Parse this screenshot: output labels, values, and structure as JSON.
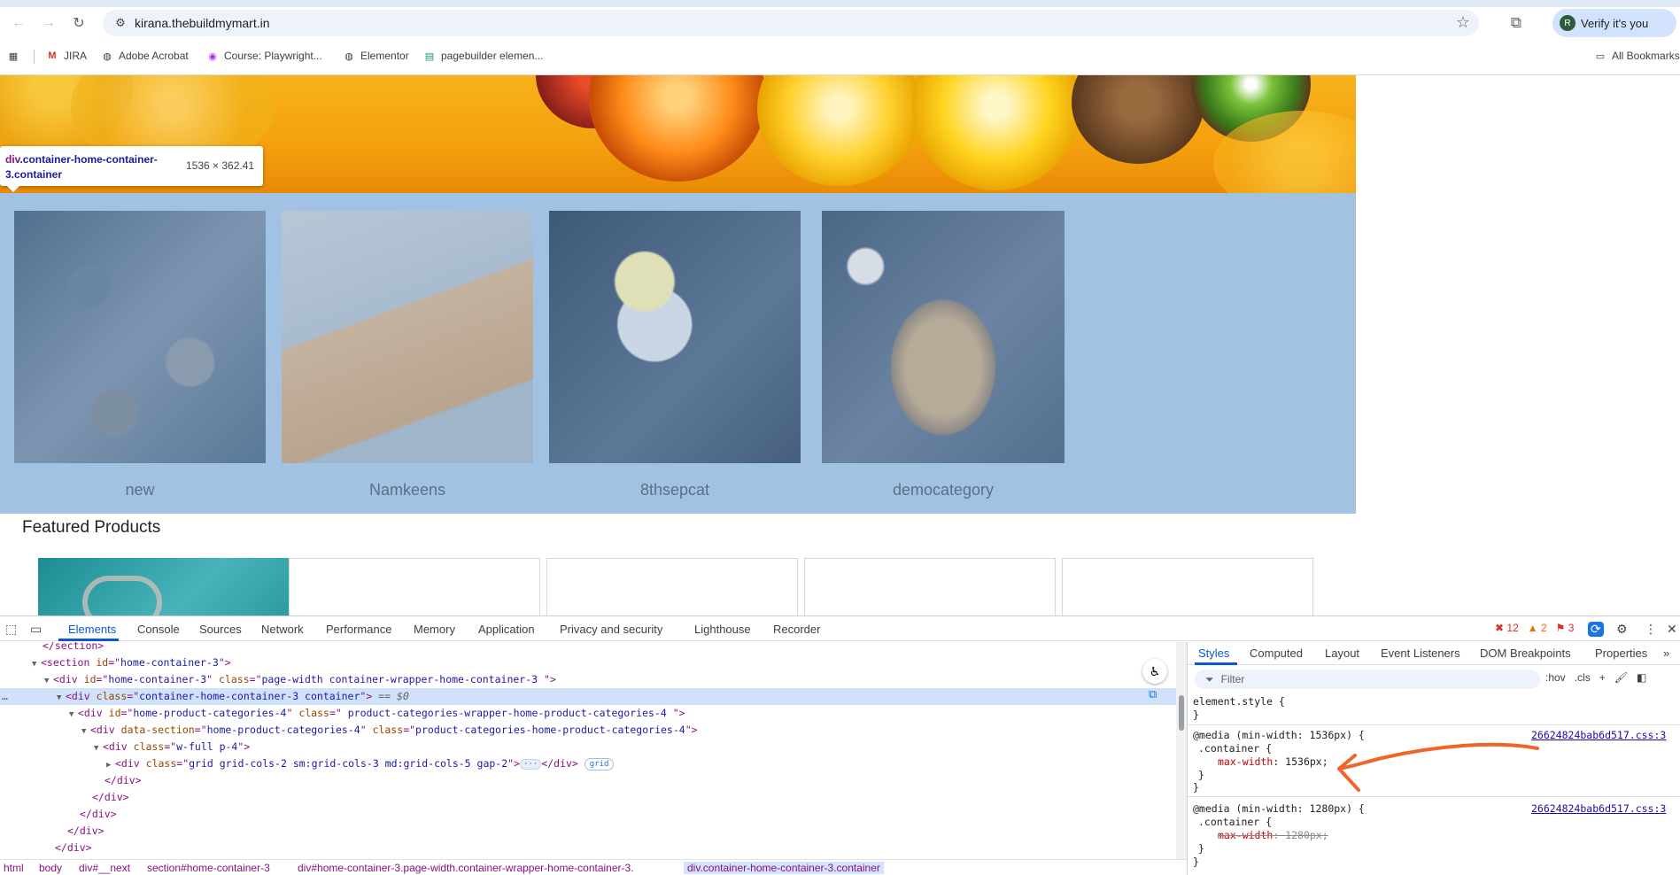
{
  "browser": {
    "url": "kirana.thebuildmymart.in",
    "verify_label": "Verify it's you",
    "avatar_letter": "R",
    "bookmarks": [
      {
        "label": "JIRA",
        "icon": "gmail-icon"
      },
      {
        "label": "Adobe Acrobat",
        "icon": "globe-icon"
      },
      {
        "label": "Course: Playwright...",
        "icon": "udemy-icon"
      },
      {
        "label": "Elementor",
        "icon": "globe-icon"
      },
      {
        "label": "pagebuilder elemen...",
        "icon": "sheets-icon"
      }
    ],
    "all_bookmarks_label": "All Bookmarks"
  },
  "page": {
    "inspect_tooltip": {
      "selector_tag": "div",
      "selector_class": ".container-home-container-3.container",
      "dimensions": "1536 × 362.41"
    },
    "categories": [
      {
        "label": "new"
      },
      {
        "label": "Namkeens"
      },
      {
        "label": "8thsepcat"
      },
      {
        "label": "democategory"
      }
    ],
    "featured_title": "Featured Products"
  },
  "devtools": {
    "tabs": [
      "Elements",
      "Console",
      "Sources",
      "Network",
      "Performance",
      "Memory",
      "Application",
      "Privacy and security",
      "Lighthouse",
      "Recorder"
    ],
    "active_tab": "Elements",
    "counts": {
      "errors": "12",
      "warnings": "2",
      "issues": "3"
    },
    "dom_lines": [
      {
        "indent": 3,
        "html": "</section>",
        "kind": "close"
      },
      {
        "indent": 3,
        "text_tag": "section",
        "attrs": [
          [
            "id",
            "home-container-3"
          ]
        ],
        "tri": "▼"
      },
      {
        "indent": 4,
        "text_tag": "div",
        "attrs": [
          [
            "id",
            "home-container-3"
          ],
          [
            "class",
            "page-width container-wrapper-home-container-3 "
          ]
        ],
        "tri": "▼"
      },
      {
        "indent": 5,
        "text_tag": "div",
        "attrs": [
          [
            "class",
            "container-home-container-3 container"
          ]
        ],
        "tri": "▼",
        "selected": true,
        "suffix": " == $0"
      },
      {
        "indent": 6,
        "text_tag": "div",
        "attrs": [
          [
            "id",
            "home-product-categories-4"
          ],
          [
            "class",
            " product-categories-wrapper-home-product-categories-4 "
          ]
        ],
        "tri": "▼"
      },
      {
        "indent": 7,
        "text_tag": "div",
        "attrs": [
          [
            "data-section",
            "home-product-categories-4"
          ],
          [
            "class",
            "product-categories-home-product-categories-4"
          ]
        ],
        "tri": "▼"
      },
      {
        "indent": 8,
        "text_tag": "div",
        "attrs": [
          [
            "class",
            "w-full p-4"
          ]
        ],
        "tri": "▼"
      },
      {
        "indent": 9,
        "text_tag": "div",
        "attrs": [
          [
            "class",
            "grid grid-cols-2 sm:grid-cols-3 md:grid-cols-5 gap-2"
          ]
        ],
        "tri": "▶",
        "collapsed": true,
        "badge": "grid"
      },
      {
        "indent": 8,
        "close_tag": "div"
      },
      {
        "indent": 7,
        "close_tag": "div"
      },
      {
        "indent": 6,
        "close_tag": "div"
      },
      {
        "indent": 5,
        "close_tag": "div"
      },
      {
        "indent": 4,
        "close_tag": "div"
      }
    ],
    "breadcrumbs": [
      "html",
      "body",
      "div#__next",
      "section#home-container-3",
      "div#home-container-3.page-width.container-wrapper-home-container-3.",
      "div.container-home-container-3.container"
    ],
    "styles": {
      "tabs": [
        "Styles",
        "Computed",
        "Layout",
        "Event Listeners",
        "DOM Breakpoints",
        "Properties"
      ],
      "filter_placeholder": "Filter",
      "hov": ":hov",
      "cls": ".cls",
      "rules": [
        {
          "lines": [
            "element.style {",
            "}"
          ]
        },
        {
          "media": "@media (min-width: 1536px) {",
          "selector": ".container {",
          "prop": "max-width",
          "value": "1536px;",
          "source": "26624824bab6d517.css:3",
          "close1": "}",
          "close2": "}",
          "struck": false
        },
        {
          "media": "@media (min-width: 1280px) {",
          "selector": ".container {",
          "prop": "max-width",
          "value": "1280px;",
          "source": "26624824bab6d517.css:3",
          "close1": "}",
          "close2": "}",
          "struck": true
        }
      ]
    }
  },
  "colors": {
    "accent": "#0b57d0",
    "highlight": "#a2c2e4",
    "annotation": "#f0642a"
  }
}
